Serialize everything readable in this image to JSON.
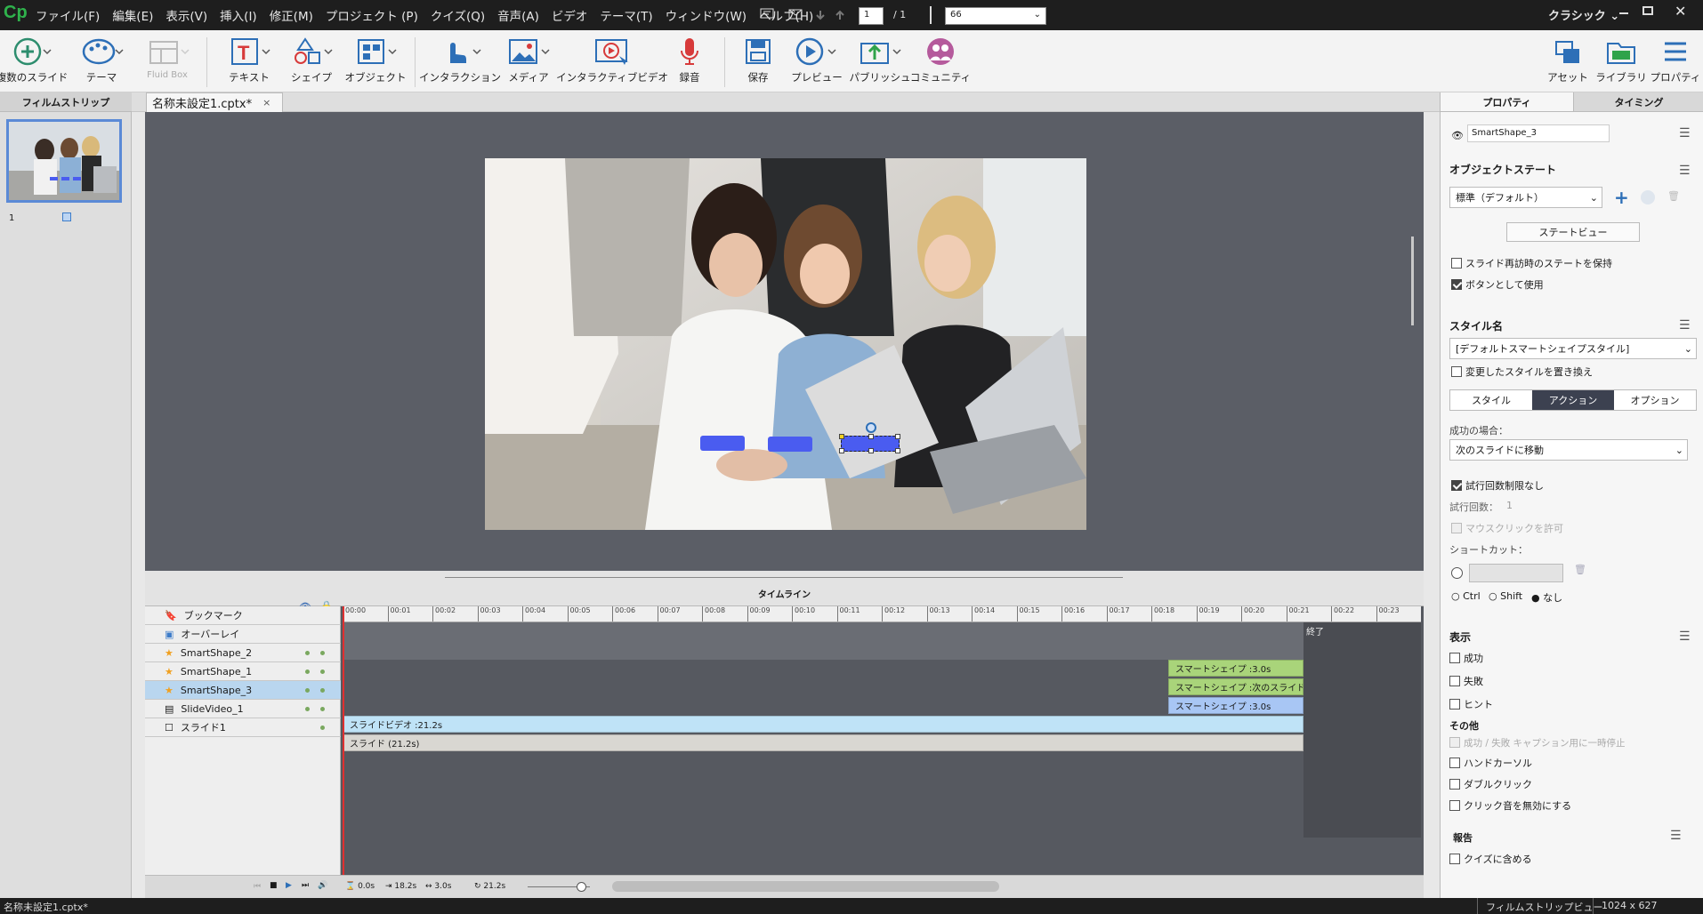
{
  "app": {
    "logo": "Cp",
    "mode": "クラシック"
  },
  "menu": [
    "ファイル(F)",
    "編集(E)",
    "表示(V)",
    "挿入(I)",
    "修正(M)",
    "プロジェクト (P)",
    "クイズ(Q)",
    "音声(A)",
    "ビデオ",
    "テーマ(T)",
    "ウィンドウ(W)",
    "ヘルプ(H)"
  ],
  "nav": {
    "current_slide": "1",
    "total": "/ 1",
    "zoom": "66"
  },
  "toolbar": {
    "new_slide": "複数のスライド",
    "theme": "テーマ",
    "fluid_box": "Fluid Box",
    "text": "テキスト",
    "shape": "シェイプ",
    "object": "オブジェクト",
    "interaction": "インタラクション",
    "media": "メディア",
    "interactive_video": "インタラクティブビデオ",
    "record": "録音",
    "save": "保存",
    "preview": "プレビュー",
    "publish": "パブリッシュ",
    "community": "コミュニティ",
    "assets": "アセット",
    "library": "ライブラリ",
    "properties": "プロパティ"
  },
  "filmstrip": {
    "title": "フィルムストリップ",
    "slide_number": "1"
  },
  "document": {
    "tab_title": "名称未設定1.cptx*",
    "close": "×"
  },
  "timeline": {
    "title": "タイムライン",
    "ticks": [
      "00:00",
      "00:01",
      "00:02",
      "00:03",
      "00:04",
      "00:05",
      "00:06",
      "00:07",
      "00:08",
      "00:09",
      "00:10",
      "00:11",
      "00:12",
      "00:13",
      "00:14",
      "00:15",
      "00:16",
      "00:17",
      "00:18",
      "00:19",
      "00:20",
      "00:21",
      "00:22",
      "00:23"
    ],
    "end_label": "終了",
    "rows": [
      {
        "name": "ブックマーク"
      },
      {
        "name": "オーバーレイ"
      },
      {
        "name": "SmartShape_2",
        "bar": "スマートシェイプ :3.0s"
      },
      {
        "name": "SmartShape_1",
        "bar": "スマートシェイプ :次のスライド..."
      },
      {
        "name": "SmartShape_3",
        "bar": "スマートシェイプ :3.0s"
      },
      {
        "name": "SlideVideo_1",
        "bar": "スライドビデオ :21.2s"
      },
      {
        "name": "スライド1",
        "bar": "スライド (21.2s)"
      }
    ],
    "footer": {
      "current": "0.0s",
      "start": "18.2s",
      "duration": "3.0s",
      "total": "21.2s"
    }
  },
  "properties": {
    "tabs": [
      "プロパティ",
      "タイミング"
    ],
    "object_name": "SmartShape_3",
    "object_state_title": "オブジェクトステート",
    "state_value": "標準（デフォルト）",
    "state_view_button": "ステートビュー",
    "retain_state": "スライド再訪時のステートを保持",
    "use_as_button": "ボタンとして使用",
    "style_name_title": "スタイル名",
    "style_value": "[デフォルトスマートシェイプスタイル]",
    "replace_style": "変更したスタイルを置き換え",
    "subtabs": [
      "スタイル",
      "アクション",
      "オプション"
    ],
    "on_success_label": "成功の場合：",
    "on_success_value": "次のスライドに移動",
    "infinite_attempts": "試行回数制限なし",
    "attempts_label": "試行回数：",
    "attempts_value": "1",
    "allow_mouse_click": "マウスクリックを許可",
    "shortcut_label": "ショートカット：",
    "modifiers": [
      "Ctrl",
      "Shift",
      "なし"
    ],
    "display_title": "表示",
    "display_items": [
      "成功",
      "失敗",
      "ヒント"
    ],
    "others_title": "その他",
    "pause_caption": "成功 / 失敗 キャプション用に一時停止",
    "hand_cursor": "ハンドカーソル",
    "double_click": "ダブルクリック",
    "disable_click_sound": "クリック音を無効にする",
    "report_title": "報告",
    "include_in_quiz": "クイズに含める"
  },
  "status": {
    "file": "名称未設定1.cptx*",
    "view": "フィルムストリップビュー",
    "resolution": "1024 x 627"
  },
  "colors": {
    "accent": "#4a5cf0",
    "bar_green": "#a9d47a",
    "bar_blue": "#a8c6f4",
    "bar_cyan": "#bfe3f7",
    "playhead": "#e03030"
  }
}
